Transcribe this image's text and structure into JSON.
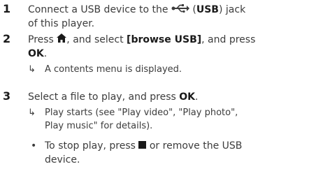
{
  "steps": [
    {
      "number": "1",
      "line1_pre": "Connect a USB device to the",
      "line1_icon": "usb-icon",
      "line1_bold": "USB",
      "line1_paren_open": " (",
      "line1_paren_close": ") jack",
      "line2": "of this player."
    },
    {
      "number": "2",
      "line1_pre": "Press ",
      "line1_icon": "home-icon",
      "line1_mid": ", and select ",
      "line1_bold": "[browse USB]",
      "line1_post": ", and press",
      "line2_bold": "OK",
      "line2_post": ".",
      "result_arrow": "↳",
      "result": "A contents menu is displayed."
    },
    {
      "number": "3",
      "line1_pre": "Select a file to play, and press ",
      "line1_bold": "OK",
      "line1_post": ".",
      "result_arrow": "↳",
      "result_line1": "Play starts (see \"Play video\", \"Play photo\",",
      "result_line2": "Play music\" for details).",
      "bullet": "•",
      "bullet_line1_pre": "To stop play, press ",
      "bullet_icon": "stop-icon",
      "bullet_line1_post": " or remove the USB",
      "bullet_line2": "device."
    }
  ]
}
